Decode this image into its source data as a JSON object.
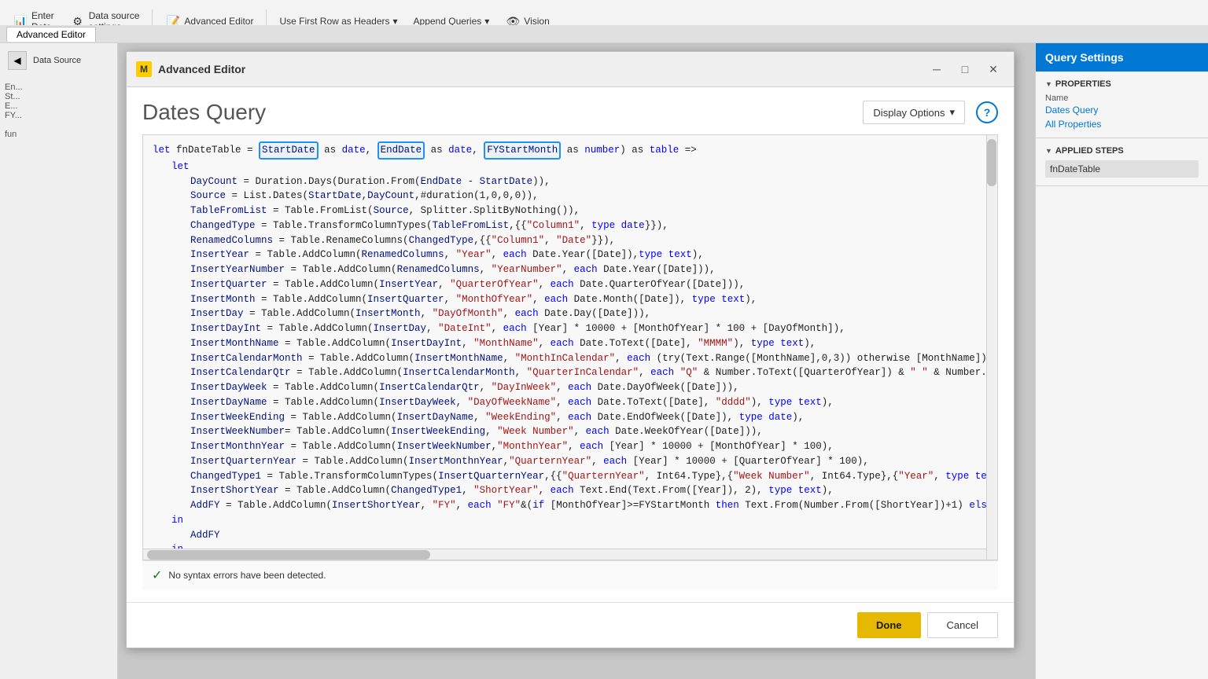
{
  "toolbar": {
    "advanced_editor_label": "Advanced Editor",
    "tab_label": "Advanced Editor",
    "use_row_headers_label": "Use First Row as Headers",
    "append_queries_label": "Append Queries",
    "vision_label": "Vision"
  },
  "modal": {
    "title": "Advanced Editor",
    "title_icon": "M",
    "query_title": "Dates Query",
    "display_options_label": "Display Options",
    "help_tooltip": "?",
    "status_text": "No syntax errors have been detected.",
    "done_label": "Done",
    "cancel_label": "Cancel"
  },
  "right_panel": {
    "header": "Query Settings",
    "properties_section": "PROPERTIES",
    "name_label": "Name",
    "name_value": "Dates Query",
    "all_properties": "All Properties",
    "applied_steps_section": "APPLIED STEPS",
    "step_name": "fnDateTable"
  },
  "code": {
    "param1": "StartDate",
    "param2": "EndDate",
    "param3": "FYStartMonth"
  }
}
